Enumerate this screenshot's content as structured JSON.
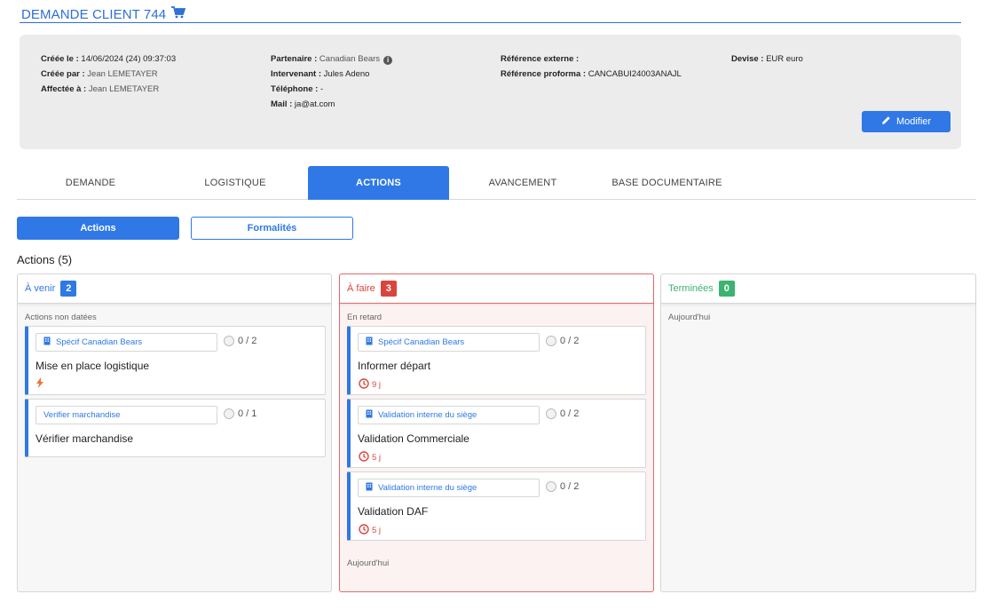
{
  "header": {
    "title": "DEMANDE CLIENT 744",
    "cart_icon": "cart-icon"
  },
  "info": {
    "col1": [
      {
        "label": "Créée le :",
        "value": "14/06/2024 (24) 09:37:03"
      },
      {
        "label": "Créée par :",
        "value": "Jean LEMETAYER"
      },
      {
        "label": "Affectée à :",
        "value": "Jean LEMETAYER"
      }
    ],
    "col2": [
      {
        "label": "Partenaire :",
        "value": "Canadian Bears"
      },
      {
        "label": "Intervenant :",
        "value": "Jules Adeno"
      },
      {
        "label": "Téléphone :",
        "value": "-"
      },
      {
        "label": "Mail :",
        "value": "ja@at.com"
      }
    ],
    "col3": [
      {
        "label": "Référence externe :",
        "value": ""
      },
      {
        "label": "Référence proforma :",
        "value": "CANCABUI24003ANAJL"
      }
    ],
    "col4": [
      {
        "label": "Devise :",
        "value": "EUR euro"
      }
    ],
    "info_icon": "i",
    "modify_label": "Modifier"
  },
  "tabs": [
    {
      "label": "DEMANDE"
    },
    {
      "label": "LOGISTIQUE"
    },
    {
      "label": "ACTIONS",
      "active": true
    },
    {
      "label": "AVANCEMENT"
    },
    {
      "label": "BASE DOCUMENTAIRE"
    }
  ],
  "subtabs": {
    "actions_label": "Actions",
    "formalites_label": "Formalités"
  },
  "section_title": "Actions (5)",
  "columns": {
    "upcoming": {
      "title": "À venir",
      "count": "2",
      "color": "#2f78e6",
      "group_label": "Actions non datées",
      "cards": [
        {
          "tag": "Spécif Canadian Bears",
          "progress": "0 / 2",
          "title": "Mise en place logistique",
          "icon": "bolt-icon"
        },
        {
          "tag": "Verifier marchandise",
          "progress": "0 / 1",
          "title": "Vérifier marchandise"
        }
      ]
    },
    "todo": {
      "title": "À faire",
      "count": "3",
      "color": "#d9453d",
      "group_label": "En retard",
      "footer_label": "Aujourd'hui",
      "cards": [
        {
          "tag": "Spécif Canadian Bears",
          "progress": "0 / 2",
          "title": "Informer départ",
          "delay": "9 j"
        },
        {
          "tag": "Validation interne du siège",
          "progress": "0 / 2",
          "title": "Validation Commerciale",
          "delay": "5 j"
        },
        {
          "tag": "Validation interne du siège",
          "progress": "0 / 2",
          "title": "Validation DAF",
          "delay": "5 j"
        }
      ]
    },
    "done": {
      "title": "Terminées",
      "count": "0",
      "color": "#3cb371",
      "group_label": "Aujourd'hui"
    }
  }
}
